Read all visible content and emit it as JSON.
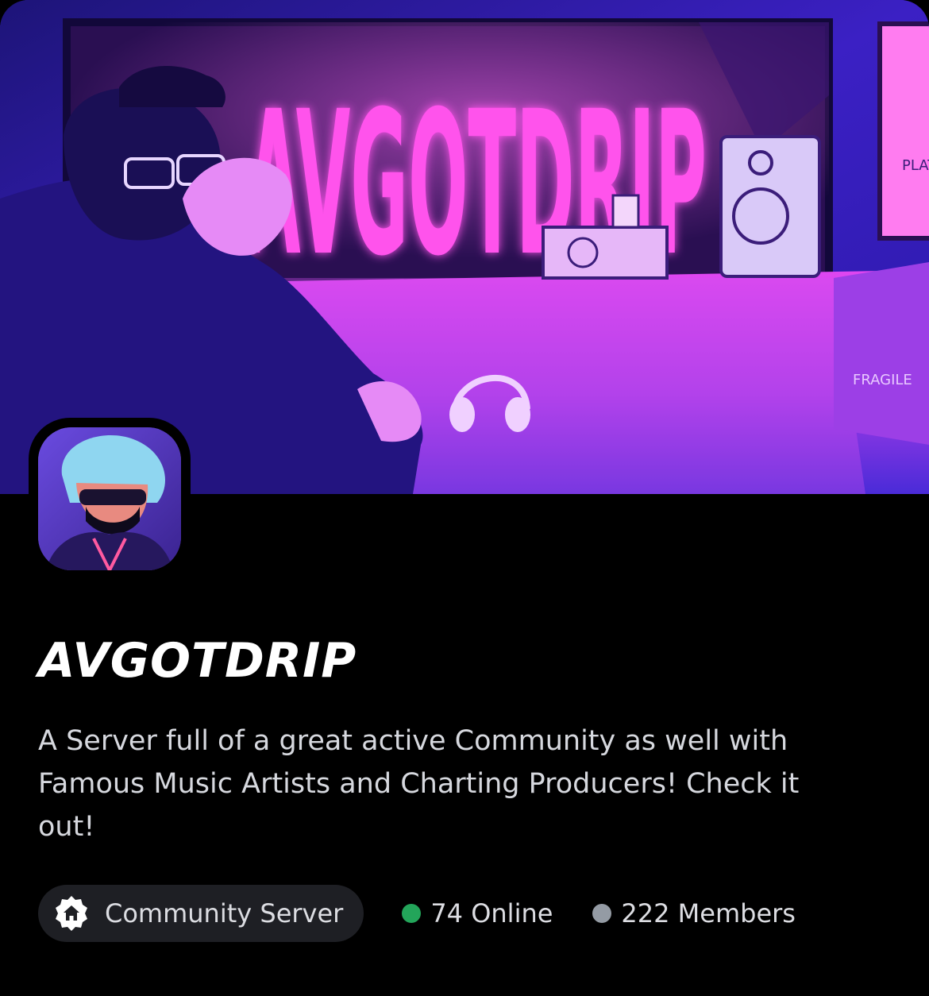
{
  "server": {
    "name": "AVGOTDRIP",
    "description": "A Server full of a great active Community as well with Famous Music Artists and Charting Producers! Check it out!",
    "banner_sign_text": "AVGOTDRIP",
    "box_label": "FRAGILE",
    "poster_label": "PLAT"
  },
  "stats": {
    "community_label": "Community Server",
    "online_label": "74 Online",
    "members_label": "222 Members"
  },
  "icons": {
    "community": "house-badge-icon",
    "online": "online-dot-icon",
    "members": "members-dot-icon"
  },
  "colors": {
    "background": "#000000",
    "online_dot": "#23a55a",
    "members_dot": "#949ba4",
    "pill_bg": "#1e1f24",
    "neon_pink": "#ff3fe6",
    "banner_blue": "#2a1aa8"
  }
}
